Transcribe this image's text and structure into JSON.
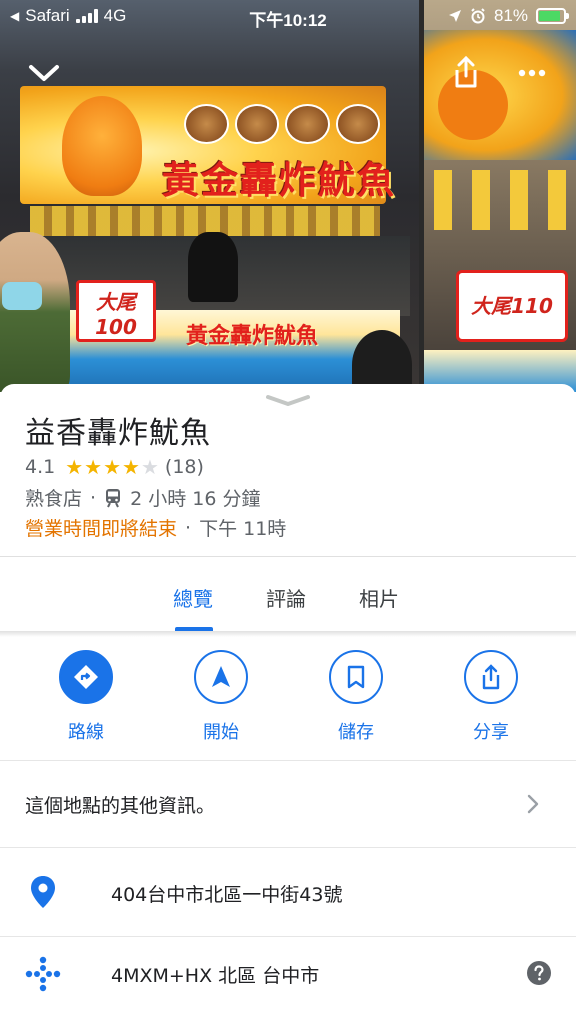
{
  "status_bar": {
    "back_app": "Safari",
    "network": "4G",
    "time": "下午10:12",
    "battery": "81%"
  },
  "photos": {
    "main_sign_text": "黃金轟炸魷魚",
    "main_counter_text": "黃金轟炸魷魚",
    "main_price": "大尾100",
    "side_price": "大尾110"
  },
  "place": {
    "name": "益香轟炸魷魚",
    "rating": "4.1",
    "stars_filled": 4,
    "review_count": "(18)",
    "category": "熟食店",
    "transit_time": "2 小時 16 分鐘",
    "hours_status": "營業時間即將結束",
    "closing_time": "下午 11時"
  },
  "tabs": [
    {
      "label": "總覽",
      "active": true
    },
    {
      "label": "評論",
      "active": false
    },
    {
      "label": "相片",
      "active": false
    }
  ],
  "actions": [
    {
      "label": "路線",
      "icon": "directions-icon"
    },
    {
      "label": "開始",
      "icon": "navigation-icon"
    },
    {
      "label": "儲存",
      "icon": "bookmark-icon"
    },
    {
      "label": "分享",
      "icon": "share-icon"
    }
  ],
  "more_info": "這個地點的其他資訊。",
  "address": "404台中市北區一中街43號",
  "plus_code": "4MXM+HX 北區 台中市",
  "colors": {
    "accent": "#1a73e8",
    "warning": "#e37400",
    "star": "#f4b400"
  }
}
